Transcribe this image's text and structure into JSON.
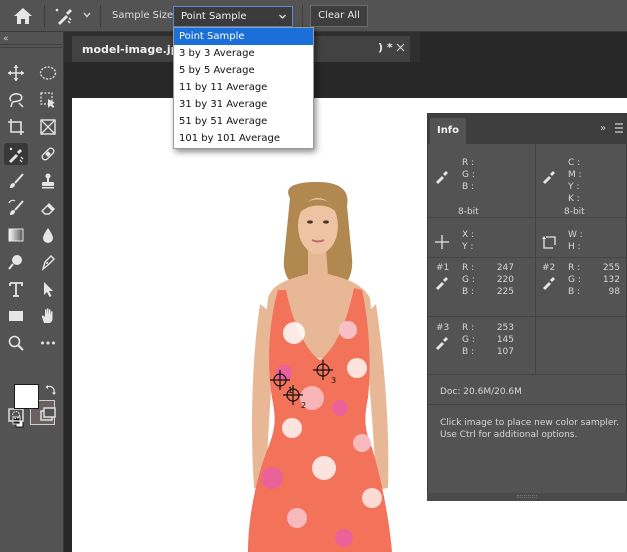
{
  "options_bar": {
    "sample_size_label": "Sample Size:",
    "sample_size_value": "Point Sample",
    "clear_all_label": "Clear All"
  },
  "dropdown": {
    "options": [
      "Point Sample",
      "3 by 3 Average",
      "5 by 5 Average",
      "11 by 11 Average",
      "31 by 31 Average",
      "51 by 51 Average",
      "101 by 101 Average"
    ],
    "selected_index": 0
  },
  "toolbar": {
    "collapse_label": "«",
    "foreground_color": "#ffffff",
    "background_color": "#6a6060"
  },
  "document_tab": {
    "title": "model-image.jpg",
    "suffix": ") *",
    "close_label": "×"
  },
  "info_panel": {
    "tab_label": "Info",
    "expand_label": "»",
    "rgb_labels": [
      "R :",
      "G :",
      "B :"
    ],
    "cmyk_labels": [
      "C :",
      "M :",
      "Y :",
      "K :"
    ],
    "bit_depth_left": "8-bit",
    "bit_depth_right": "8-bit",
    "xy_labels": [
      "X :",
      "Y :"
    ],
    "wh_labels": [
      "W :",
      "H :"
    ],
    "samplers": [
      {
        "id": "#1",
        "r": "247",
        "g": "220",
        "b": "225"
      },
      {
        "id": "#2",
        "r": "255",
        "g": "132",
        "b": "98"
      },
      {
        "id": "#3",
        "r": "253",
        "g": "145",
        "b": "107"
      }
    ],
    "doc_size": "Doc: 20.6M/20.6M",
    "help_line1": "Click image to place new color sampler.",
    "help_line2": "Use Ctrl for additional options."
  },
  "colors": {
    "accent": "#1a6fd8",
    "dress": "#f2725a",
    "panel": "#535353"
  }
}
